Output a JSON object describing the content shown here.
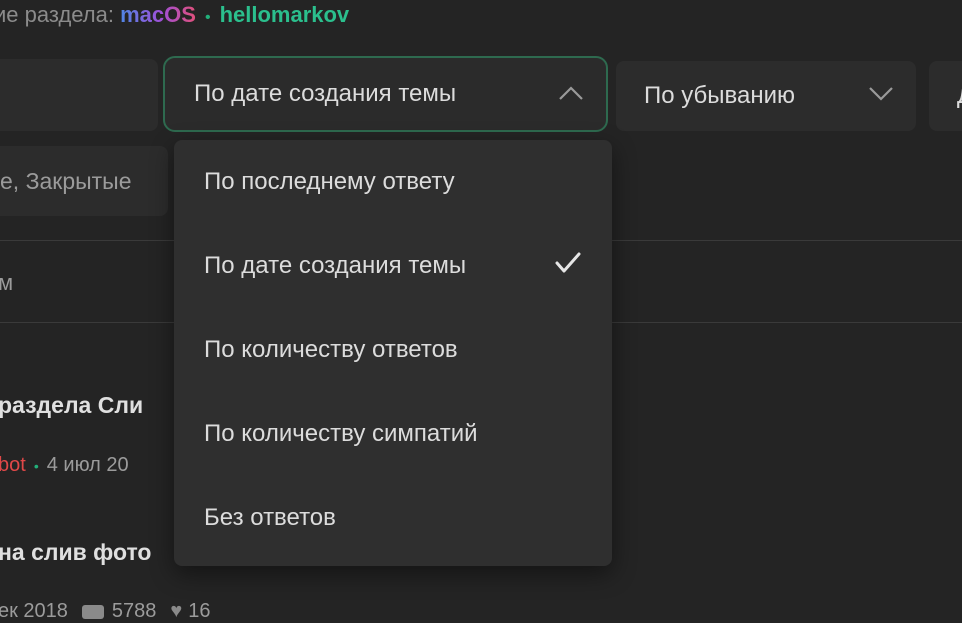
{
  "header": {
    "moderators_label": "ие раздела:",
    "moderators": [
      "macOS",
      "hellomarkov"
    ]
  },
  "controls": {
    "sort_selected": "По дате создания темы",
    "order_selected": "По убыванию",
    "third_field_fragment": "Д",
    "filter_fragment": "е, Закрытые"
  },
  "sort_dropdown": {
    "options": [
      "По последнему ответу",
      "По дате создания темы",
      "По количеству ответов",
      "По количеству симпатий",
      "Без ответов"
    ],
    "selected_index": 1
  },
  "tabs": {
    "fragment": "м"
  },
  "threads": [
    {
      "title_fragment": "раздела Сли",
      "author_fragment": "bot",
      "date_fragment": "4 июл 20"
    },
    {
      "title_fragment": "на слив фото",
      "date_fragment": "ек 2018",
      "replies": "5788",
      "likes": "16"
    }
  ],
  "colors": {
    "background": "#242424",
    "accent_green": "#2bbf8d",
    "focus_border": "#2e6a4f",
    "author_red": "#e04848"
  }
}
